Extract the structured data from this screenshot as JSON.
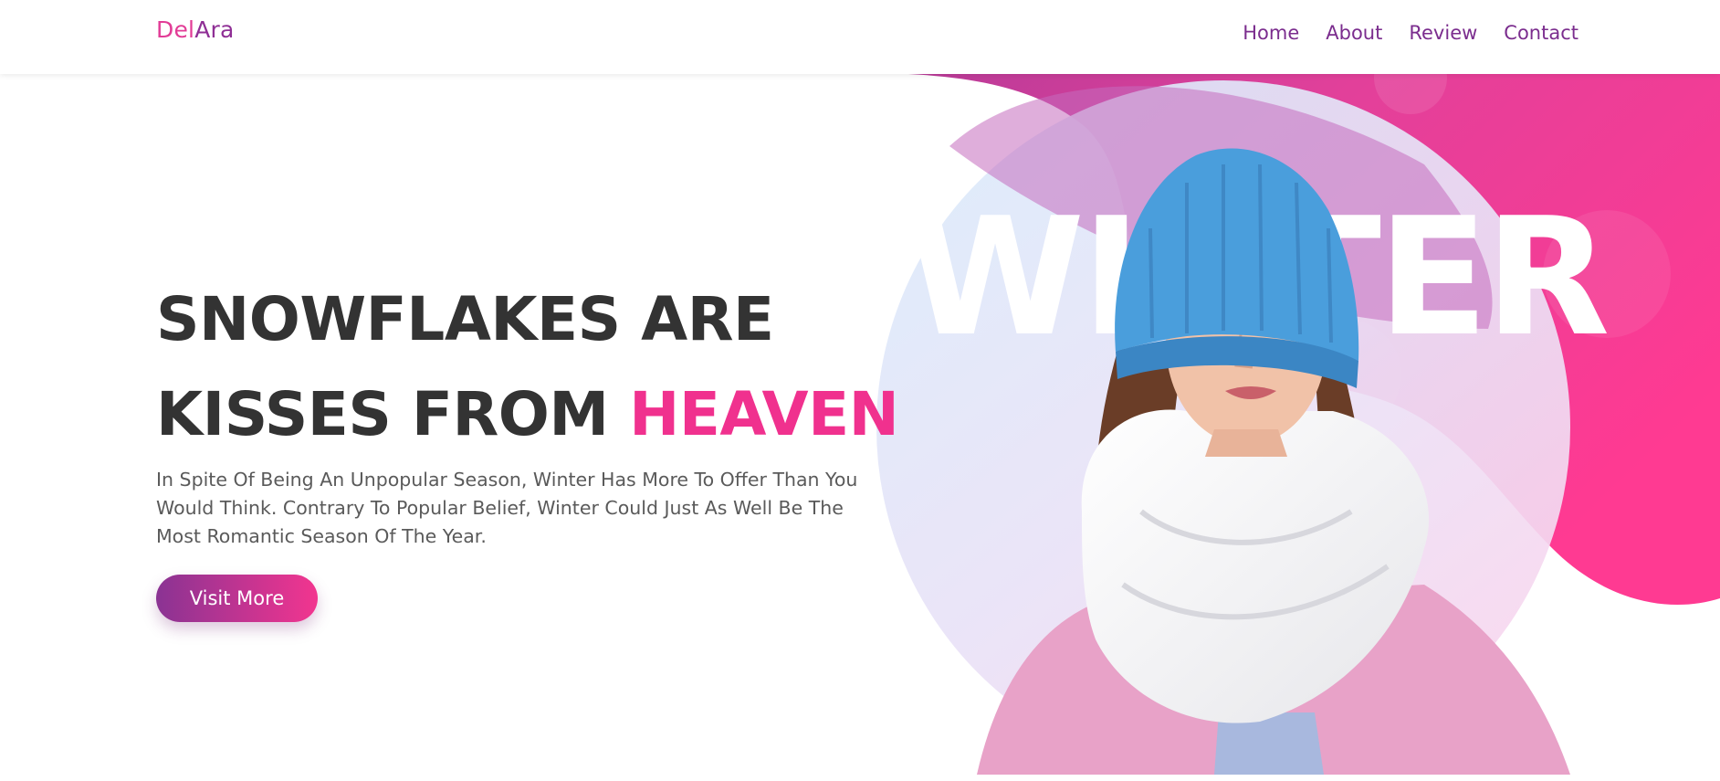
{
  "header": {
    "logo_part1": "Del",
    "logo_part2": "Ara",
    "nav": [
      "Home",
      "About",
      "Review",
      "Contact"
    ]
  },
  "hero": {
    "title_line1": "SNOWFLAKES ARE",
    "title_line2_prefix": "KISSES FROM ",
    "title_line2_accent": "HEAVEN",
    "description": "In Spite Of Being An Unpopular Season, Winter Has More To Offer Than You Would Think. Contrary To Popular Belief, Winter Could Just As Well Be The Most Romantic Season Of The Year.",
    "button_label": "Visit More",
    "background_word": "WINTER"
  },
  "colors": {
    "brand_pink": "#f0318e",
    "brand_purple": "#8a3393",
    "heading_text": "#333333",
    "body_text": "#5a5a5a"
  }
}
